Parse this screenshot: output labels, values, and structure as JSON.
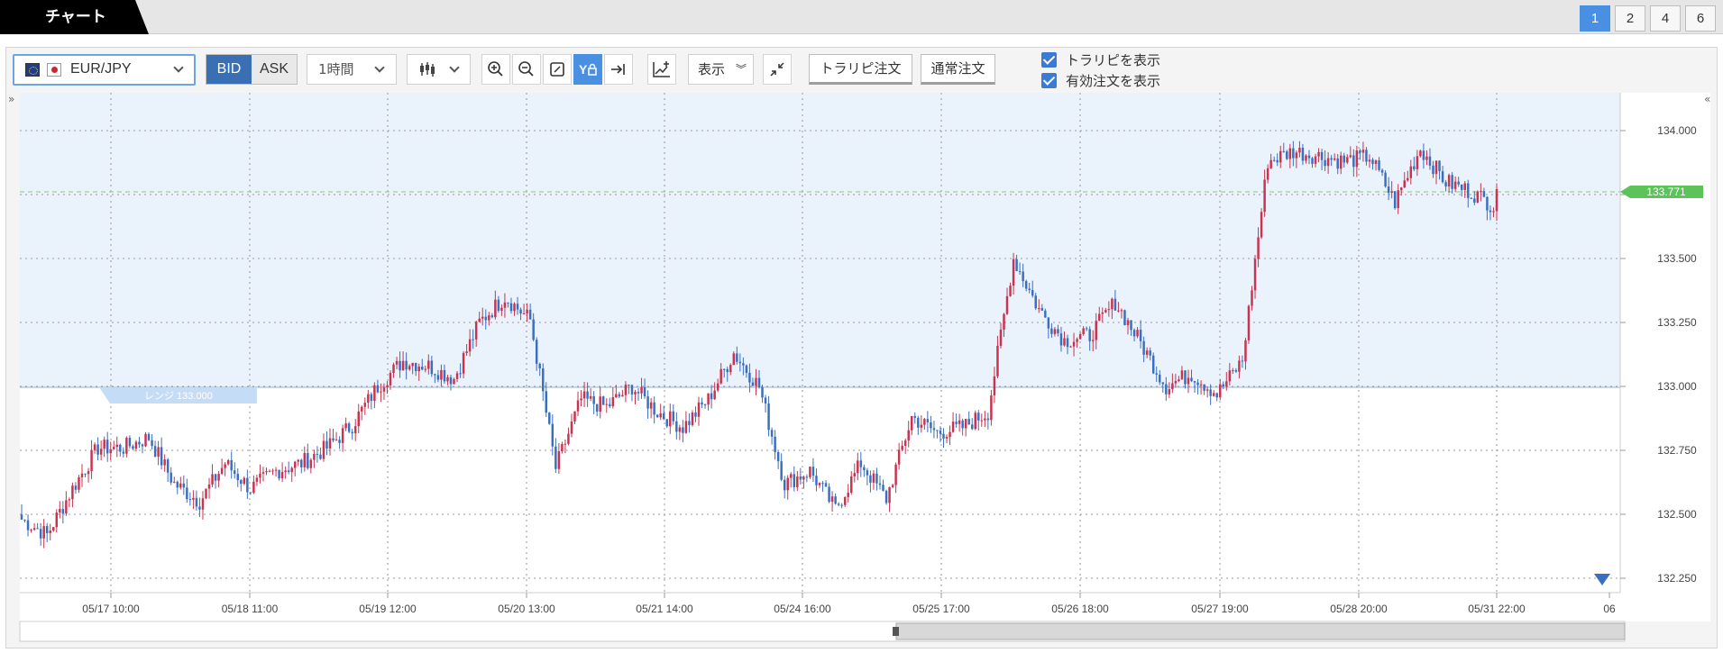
{
  "tabbar": {
    "chart_tab": "チャート",
    "layouts": [
      "1",
      "2",
      "4",
      "6"
    ],
    "active_layout": "1"
  },
  "toolbar": {
    "pair": "EUR/JPY",
    "bid_label": "BID",
    "ask_label": "ASK",
    "timeframe": "1時間",
    "display_label": "表示",
    "trail_order_button": "トラリピ注文",
    "normal_order_button": "通常注文",
    "show_traripi": "トラリピを表示",
    "show_active_orders": "有効注文を表示"
  },
  "chart": {
    "range_label": "レンジ 133.000",
    "price_axis": [
      "134.000",
      "133.750",
      "133.500",
      "133.250",
      "133.000",
      "132.750",
      "132.500",
      "132.250"
    ],
    "time_axis": [
      "05/17 10:00",
      "05/18 11:00",
      "05/19 12:00",
      "05/20 13:00",
      "05/21 14:00",
      "05/24 16:00",
      "05/25 17:00",
      "05/26 18:00",
      "05/27 19:00",
      "05/28 20:00",
      "05/31 22:00",
      "06"
    ],
    "current_price": "133.771",
    "colors": {
      "up": "#c8334f",
      "down": "#3a6fc0",
      "range_fill": "#eaf2fc",
      "current_marker": "#5cc25a"
    }
  },
  "chart_data": {
    "type": "candlestick",
    "symbol": "EUR/JPY",
    "interval": "1時間",
    "ylim": [
      132.25,
      134.0
    ],
    "ylabel": "",
    "x_ticks": [
      "05/17 10:00",
      "05/18 11:00",
      "05/19 12:00",
      "05/20 13:00",
      "05/21 14:00",
      "05/24 16:00",
      "05/25 17:00",
      "05/26 18:00",
      "05/27 19:00",
      "05/28 20:00",
      "05/31 22:00"
    ],
    "range_line": 133.0,
    "last_price": 133.771,
    "trend_close": [
      132.48,
      132.42,
      132.6,
      132.76,
      132.76,
      132.8,
      132.62,
      132.55,
      132.7,
      132.6,
      132.67,
      132.7,
      132.76,
      132.85,
      133.0,
      133.1,
      133.08,
      133.03,
      133.25,
      133.35,
      133.26,
      132.68,
      132.95,
      132.92,
      133.0,
      132.9,
      132.84,
      132.95,
      133.13,
      133.0,
      132.62,
      132.67,
      132.52,
      132.7,
      132.56,
      132.88,
      132.82,
      132.84,
      132.9,
      133.5,
      133.3,
      133.18,
      133.2,
      133.33,
      133.17,
      133.0,
      133.05,
      132.97,
      133.1,
      133.88,
      133.92,
      133.9,
      133.88,
      133.9,
      133.72,
      133.93,
      133.8,
      133.76,
      133.7
    ]
  }
}
